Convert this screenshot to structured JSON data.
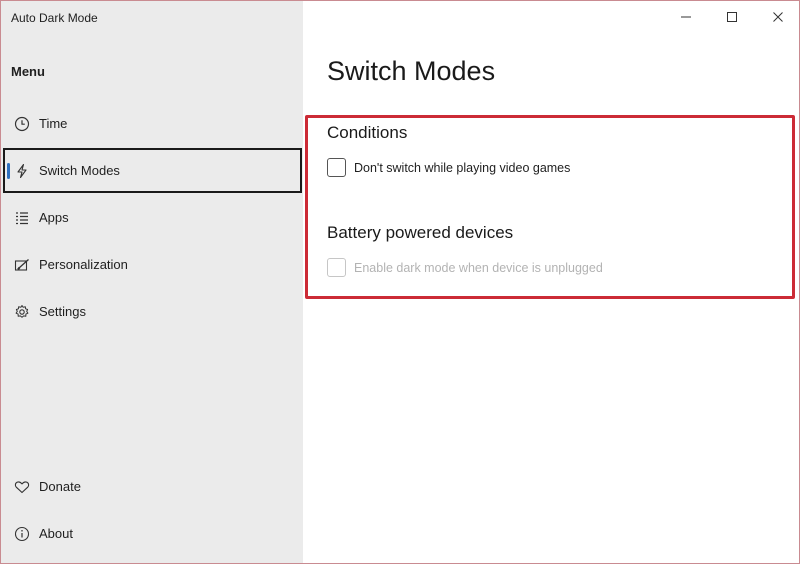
{
  "window": {
    "title": "Auto Dark Mode"
  },
  "sidebar": {
    "menu_heading": "Menu",
    "items": [
      {
        "label": "Time",
        "icon": "clock-icon",
        "selected": false
      },
      {
        "label": "Switch Modes",
        "icon": "lightning-icon",
        "selected": true
      },
      {
        "label": "Apps",
        "icon": "list-icon",
        "selected": false
      },
      {
        "label": "Personalization",
        "icon": "personalization-icon",
        "selected": false
      },
      {
        "label": "Settings",
        "icon": "gear-icon",
        "selected": false
      }
    ],
    "footer_items": [
      {
        "label": "Donate",
        "icon": "heart-icon"
      },
      {
        "label": "About",
        "icon": "info-icon"
      }
    ],
    "selection_color": "#2f6fbf"
  },
  "caption_buttons": [
    "minimize",
    "maximize",
    "close"
  ],
  "main": {
    "page_title": "Switch Modes",
    "sections": [
      {
        "title": "Conditions",
        "checkbox": {
          "label": "Don't switch while playing video games",
          "checked": false,
          "disabled": false
        }
      },
      {
        "title": "Battery powered devices",
        "checkbox": {
          "label": "Enable dark mode when device is unplugged",
          "checked": false,
          "disabled": true
        }
      }
    ],
    "highlight_color": "#cc2b36"
  }
}
